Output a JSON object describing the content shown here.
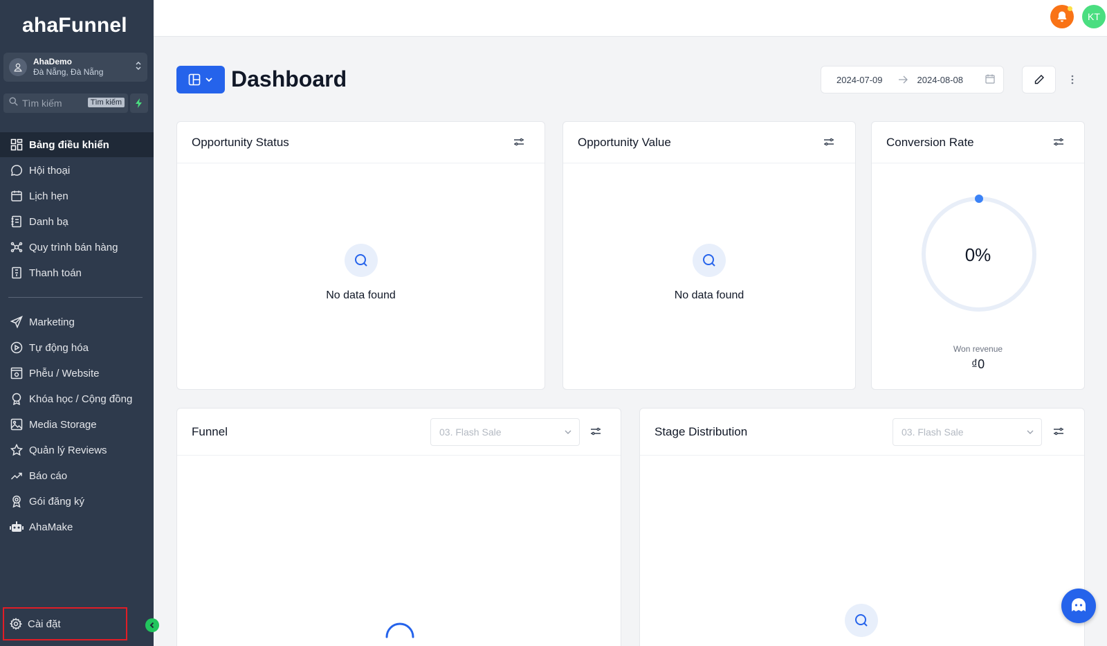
{
  "app": {
    "logo": "ahaFunnel"
  },
  "account": {
    "name": "AhaDemo",
    "location": "Đà Nẵng, Đà Nẵng"
  },
  "search": {
    "placeholder": "Tìm kiếm",
    "shortcut": "Tìm kiếm"
  },
  "sidebar": {
    "items": [
      {
        "label": "Bảng điều khiển",
        "icon": "dashboard-grid-icon",
        "active": true
      },
      {
        "label": "Hội thoại",
        "icon": "chat-bubble-icon"
      },
      {
        "label": "Lịch hẹn",
        "icon": "calendar-icon"
      },
      {
        "label": "Danh bạ",
        "icon": "contacts-book-icon"
      },
      {
        "label": "Quy trình bán hàng",
        "icon": "pipeline-icon"
      },
      {
        "label": "Thanh toán",
        "icon": "payment-receipt-icon"
      },
      {
        "label": "Marketing",
        "icon": "send-plane-icon"
      },
      {
        "label": "Tự động hóa",
        "icon": "automation-play-icon"
      },
      {
        "label": "Phễu / Website",
        "icon": "website-icon"
      },
      {
        "label": "Khóa học / Cộng đồng",
        "icon": "award-icon"
      },
      {
        "label": "Media Storage",
        "icon": "image-icon"
      },
      {
        "label": "Quản lý Reviews",
        "icon": "star-icon"
      },
      {
        "label": "Báo cáo",
        "icon": "trend-chart-icon"
      },
      {
        "label": "Gói đăng ký",
        "icon": "subscription-badge-icon"
      },
      {
        "label": "AhaMake",
        "icon": "robot-icon"
      }
    ],
    "settings_label": "Cài đặt"
  },
  "topbar": {
    "avatar_initials": "KT"
  },
  "header": {
    "title": "Dashboard",
    "date_from": "2024-07-09",
    "date_to": "2024-08-08"
  },
  "cards": {
    "opportunity_status": {
      "title": "Opportunity Status",
      "empty_text": "No data found"
    },
    "opportunity_value": {
      "title": "Opportunity Value",
      "empty_text": "No data found"
    },
    "conversion_rate": {
      "title": "Conversion Rate",
      "percent": "0%",
      "won_label": "Won revenue",
      "won_value": "₫0"
    },
    "funnel": {
      "title": "Funnel",
      "select_value": "03. Flash Sale"
    },
    "stage_distribution": {
      "title": "Stage Distribution",
      "select_value": "03. Flash Sale"
    }
  },
  "colors": {
    "sidebar_bg": "#2e3a4c",
    "primary": "#2563eb",
    "accent_green": "#22c55e",
    "notification": "#f97316"
  }
}
